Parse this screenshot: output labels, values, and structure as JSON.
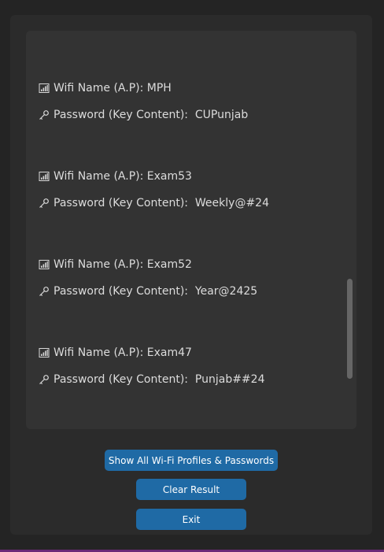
{
  "results": [
    {
      "ssid_label": "Wifi Name (A.P): ",
      "ssid": "MPH",
      "password_label": "Password (Key Content):  ",
      "password": "CUPunjab"
    },
    {
      "ssid_label": "Wifi Name (A.P): ",
      "ssid": "Exam53",
      "password_label": "Password (Key Content):  ",
      "password": "Weekly@#24"
    },
    {
      "ssid_label": "Wifi Name (A.P): ",
      "ssid": "Exam52",
      "password_label": "Password (Key Content):  ",
      "password": "Year@2425"
    },
    {
      "ssid_label": "Wifi Name (A.P): ",
      "ssid": "Exam47",
      "password_label": "Password (Key Content):  ",
      "password": "Punjab##24"
    }
  ],
  "icons": {
    "wifi": "signal-bars-icon",
    "password": "key-icon"
  },
  "buttons": {
    "show_all": "Show All Wi-Fi Profiles & Passwords",
    "clear": "Clear Result",
    "exit": "Exit"
  },
  "colors": {
    "background": "#242424",
    "panel": "#2b2b2b",
    "result_box": "#333333",
    "button": "#1f6aa5",
    "text": "#dcdcdc"
  }
}
